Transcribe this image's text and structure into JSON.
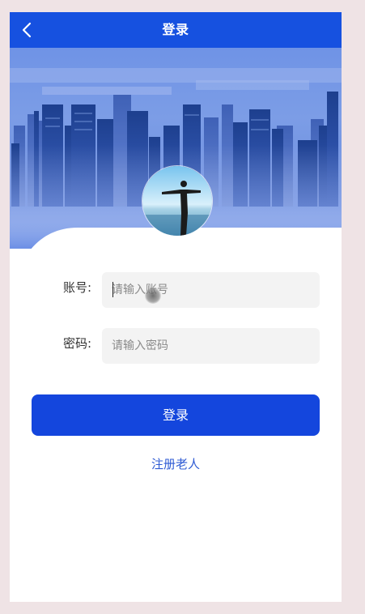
{
  "header": {
    "title": "登录",
    "back_icon": "chevron-left-icon"
  },
  "banner": {
    "background": "city-skyline",
    "avatar": "person-arms-spread-at-sea"
  },
  "form": {
    "account_label": "账号:",
    "account_placeholder": "请输入账号",
    "account_value": "",
    "password_label": "密码:",
    "password_placeholder": "请输入密码",
    "password_value": ""
  },
  "actions": {
    "login_label": "登录",
    "register_label": "注册老人"
  },
  "colors": {
    "primary": "#1651e0",
    "button": "#1446dd",
    "link": "#2f5bd3",
    "input_bg": "#f3f3f3",
    "page_bg": "#efe3e5"
  }
}
